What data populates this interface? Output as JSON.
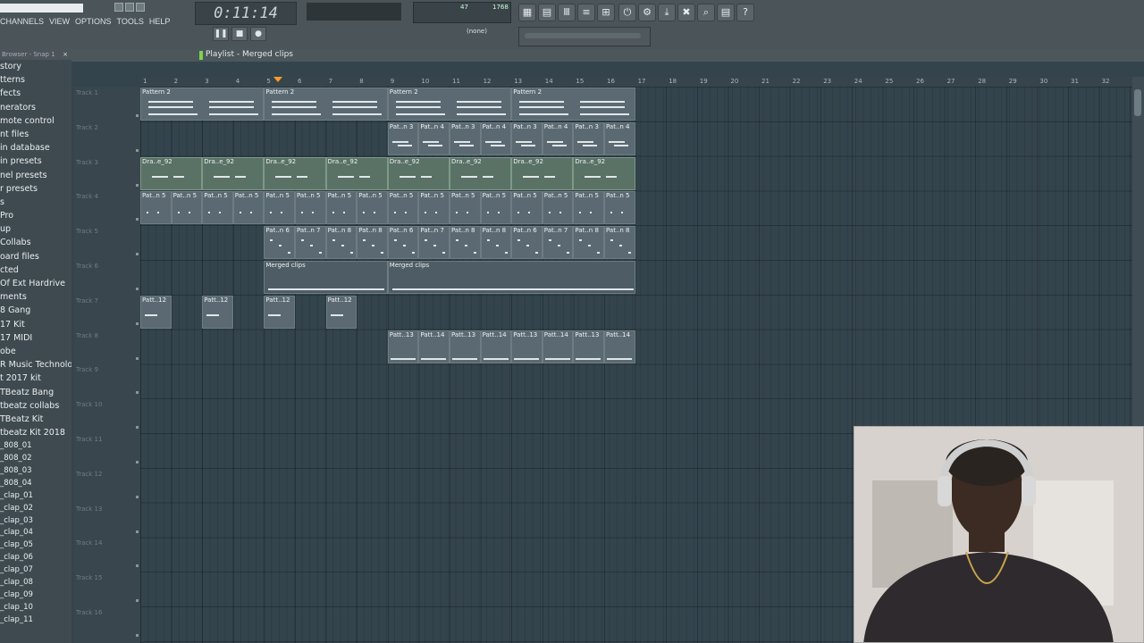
{
  "app": {
    "time": "0:11:14"
  },
  "menu": [
    "CHANNELS",
    "VIEW",
    "OPTIONS",
    "TOOLS",
    "HELP"
  ],
  "meter": {
    "left": "47",
    "right": "1768"
  },
  "pattern_selector": "(none)",
  "playlist": {
    "title": "Playlist - Merged clips"
  },
  "browser": {
    "header": "Browser - Snap 1",
    "items": [
      "story",
      "tterns",
      "fects",
      "nerators",
      "mote control",
      "nt files",
      "in database",
      "in presets",
      "nel presets",
      "r presets",
      "s",
      "Pro",
      "up",
      " Collabs",
      "oard files",
      "cted",
      " Of Ext Hardrive",
      "ments",
      "8 Gang",
      "17 Kit",
      "17 MIDI",
      "obe",
      "R Music Technology",
      "t 2017 kit",
      "TBeatz Bang",
      "tbeatz collabs",
      "TBeatz Kit",
      "tbeatz Kit 2018"
    ],
    "sub_items": [
      "_808_01",
      "_808_02",
      "_808_03",
      "_808_04",
      "_clap_01",
      "_clap_02",
      "_clap_03",
      "_clap_04",
      "_clap_05",
      "_clap_06",
      "_clap_07",
      "_clap_08",
      "_clap_09",
      "_clap_10",
      "_clap_11"
    ]
  },
  "tracks": [
    "Track 1",
    "Track 2",
    "Track 3",
    "Track 4",
    "Track 5",
    "Track 6",
    "Track 7",
    "Track 8",
    "Track 9",
    "Track 10",
    "Track 11",
    "Track 12",
    "Track 13",
    "Track 14",
    "Track 15",
    "Track 16"
  ],
  "ruler": [
    "1",
    "2",
    "3",
    "4",
    "5",
    "6",
    "7",
    "8",
    "9",
    "10",
    "11",
    "12",
    "13",
    "14",
    "15",
    "16",
    "17",
    "18",
    "19",
    "20",
    "21",
    "22",
    "23",
    "24",
    "25",
    "26",
    "27",
    "28",
    "29",
    "30",
    "31",
    "32"
  ],
  "clips": {
    "pattern2": "Pattern 2",
    "pat3": "Pat..n 3",
    "pat4": "Pat..n 4",
    "drake": "Dra..e_92",
    "pat5": "Pat..n 5",
    "pat6": "Pat..n 6",
    "pat7": "Pat..n 7",
    "pat8": "Pat..n 8",
    "merged": "Merged clips",
    "patt12": "Patt..12",
    "patt13": "Patt..13",
    "patt14": "Patt..14"
  }
}
